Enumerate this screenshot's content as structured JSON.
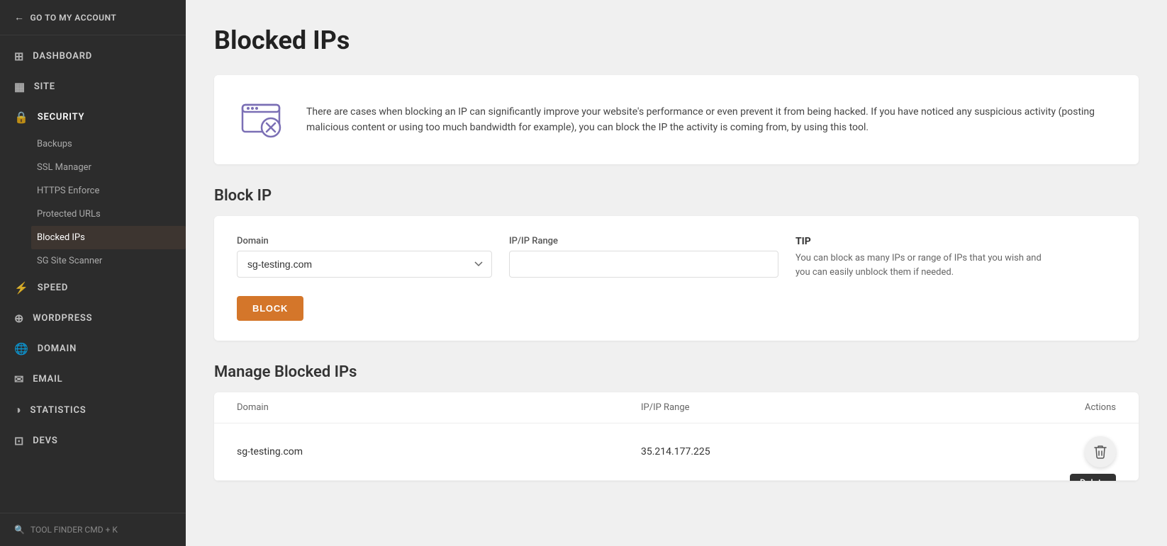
{
  "sidebar": {
    "back_label": "GO TO MY ACCOUNT",
    "nav_items": [
      {
        "id": "dashboard",
        "label": "DASHBOARD",
        "icon": "⊞"
      },
      {
        "id": "site",
        "label": "SITE",
        "icon": "▦"
      },
      {
        "id": "security",
        "label": "SECURITY",
        "icon": "🔒",
        "active": true,
        "sub_items": [
          {
            "id": "backups",
            "label": "Backups"
          },
          {
            "id": "ssl-manager",
            "label": "SSL Manager"
          },
          {
            "id": "https-enforce",
            "label": "HTTPS Enforce"
          },
          {
            "id": "protected-urls",
            "label": "Protected URLs"
          },
          {
            "id": "blocked-ips",
            "label": "Blocked IPs",
            "active": true
          },
          {
            "id": "sg-site-scanner",
            "label": "SG Site Scanner"
          }
        ]
      },
      {
        "id": "speed",
        "label": "SPEED",
        "icon": "⚡"
      },
      {
        "id": "wordpress",
        "label": "WORDPRESS",
        "icon": "⊕"
      },
      {
        "id": "domain",
        "label": "DOMAIN",
        "icon": "🌐"
      },
      {
        "id": "email",
        "label": "EMAIL",
        "icon": "✉"
      },
      {
        "id": "statistics",
        "label": "STATISTICS",
        "icon": "◑"
      },
      {
        "id": "devs",
        "label": "DEVS",
        "icon": "⊡"
      }
    ],
    "tool_finder": "TOOL FINDER CMD + K"
  },
  "page": {
    "title": "Blocked IPs",
    "info_text": "There are cases when blocking an IP can significantly improve your website's performance or even prevent it from being hacked. If you have noticed any suspicious activity (posting malicious content or using too much bandwidth for example), you can block the IP the activity is coming from, by using this tool.",
    "block_section": {
      "title": "Block IP",
      "domain_label": "Domain",
      "domain_value": "sg-testing.com",
      "ip_label": "IP/IP Range",
      "ip_placeholder": "",
      "tip_label": "TIP",
      "tip_text": "You can block as many IPs or range of IPs that you wish and you can easily unblock them if needed.",
      "block_button": "BLOCK"
    },
    "manage_section": {
      "title": "Manage Blocked IPs",
      "table": {
        "headers": [
          "Domain",
          "IP/IP Range",
          "Actions"
        ],
        "rows": [
          {
            "domain": "sg-testing.com",
            "ip": "35.214.177.225"
          }
        ]
      }
    },
    "delete_tooltip": "Delete"
  }
}
